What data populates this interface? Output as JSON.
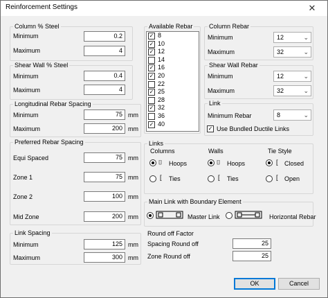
{
  "window": {
    "title": "Reinforcement Settings",
    "close_glyph": "✕"
  },
  "column_steel": {
    "title": "Column % Steel",
    "minimum_label": "Minimum",
    "minimum_value": "0.2",
    "maximum_label": "Maximum",
    "maximum_value": "4"
  },
  "shear_wall_steel": {
    "title": "Shear Wall % Steel",
    "minimum_label": "Minimum",
    "minimum_value": "0.4",
    "maximum_label": "Maximum",
    "maximum_value": "4"
  },
  "longitudinal_spacing": {
    "title": "Longitudinal Rebar Spacing",
    "minimum_label": "Minimum",
    "minimum_value": "75",
    "minimum_unit": "mm",
    "maximum_label": "Maximum",
    "maximum_value": "200",
    "maximum_unit": "mm"
  },
  "preferred_spacing": {
    "title": "Preferred Rebar Spacing",
    "rows": [
      {
        "label": "Equi Spaced",
        "value": "75",
        "unit": "mm"
      },
      {
        "label": "Zone 1",
        "value": "75",
        "unit": "mm"
      },
      {
        "label": "Zone 2",
        "value": "100",
        "unit": "mm"
      },
      {
        "label": "Mid Zone",
        "value": "200",
        "unit": "mm"
      }
    ]
  },
  "link_spacing": {
    "title": "Link Spacing",
    "minimum_label": "Minimum",
    "minimum_value": "125",
    "minimum_unit": "mm",
    "maximum_label": "Maximum",
    "maximum_value": "300",
    "maximum_unit": "mm"
  },
  "available_rebar": {
    "title": "Available Rebar",
    "items": [
      {
        "label": "8",
        "checked": true
      },
      {
        "label": "10",
        "checked": true
      },
      {
        "label": "12",
        "checked": true
      },
      {
        "label": "14",
        "checked": false
      },
      {
        "label": "16",
        "checked": true
      },
      {
        "label": "20",
        "checked": true
      },
      {
        "label": "22",
        "checked": false
      },
      {
        "label": "25",
        "checked": true
      },
      {
        "label": "28",
        "checked": false
      },
      {
        "label": "32",
        "checked": true
      },
      {
        "label": "36",
        "checked": false
      },
      {
        "label": "40",
        "checked": true
      }
    ],
    "check_glyph": "✓"
  },
  "column_rebar": {
    "title": "Column Rebar",
    "minimum_label": "Minimum",
    "minimum_value": "12",
    "maximum_label": "Maximum",
    "maximum_value": "32"
  },
  "shear_wall_rebar": {
    "title": "Shear Wall Rebar",
    "minimum_label": "Minimum",
    "minimum_value": "12",
    "maximum_label": "Maximum",
    "maximum_value": "32"
  },
  "link": {
    "title": "Link",
    "minimum_rebar_label": "Minimum Rebar",
    "minimum_rebar_value": "8",
    "bundled_label": "Use Bundled Ductile Links",
    "bundled_checked": true
  },
  "links": {
    "title": "Links",
    "columns": {
      "title": "Columns",
      "hoops_label": "Hoops",
      "ties_label": "Ties",
      "selected": "hoops"
    },
    "walls": {
      "title": "Walls",
      "hoops_label": "Hoops",
      "ties_label": "Ties",
      "selected": "hoops"
    },
    "tie_style": {
      "title": "Tie Style",
      "closed_label": "Closed",
      "open_label": "Open",
      "selected": "closed"
    }
  },
  "main_link": {
    "title": "Main Link with Boundary Element",
    "master_label": "Master Link",
    "horizontal_label": "Horizontal Rebar",
    "selected": "master"
  },
  "round_off": {
    "title": "Round off Factor",
    "spacing_label": "Spacing Round off",
    "spacing_value": "25",
    "zone_label": "Zone Round off",
    "zone_value": "25"
  },
  "buttons": {
    "ok_label": "OK",
    "cancel_label": "Cancel"
  },
  "icons": {
    "dropdown": "chevron-down-icon",
    "hoop": "hoop-icon",
    "tie": "tie-icon"
  }
}
